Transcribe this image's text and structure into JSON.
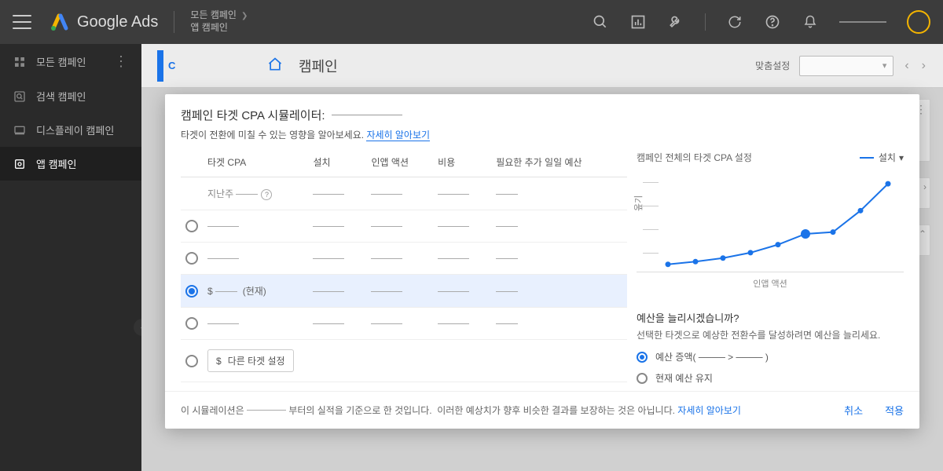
{
  "brand": "Google Ads",
  "crumb1": "모든 캠페인",
  "crumb2": "앱 캠페인",
  "sidebar": {
    "items": [
      {
        "label": "모든 캠페인"
      },
      {
        "label": "검색 캠페인"
      },
      {
        "label": "디스플레이 캠페인"
      },
      {
        "label": "앱 캠페인"
      }
    ]
  },
  "subbar": {
    "title": "캠페인",
    "custom": "맞춤설정"
  },
  "modal": {
    "title": "캠페인 타겟 CPA 시뮬레이터:",
    "subtitle_pre": "타겟이 전환에 미칠 수 있는 영향을 알아보세요. ",
    "subtitle_link": "자세히 알아보기",
    "th_target": "타겟 CPA",
    "th_install": "설치",
    "th_inapp": "인앱 액션",
    "th_cost": "비용",
    "th_extra": "필요한 추가 일일 예산",
    "lastweek": "지난주",
    "current_label": "(현재)",
    "other_target": "다른 타겟 설정",
    "currency": "$",
    "chart_title": "캠페인 전체의 타겟 CPA 설정",
    "chart_metric": "설치",
    "chart_ylabel": "옾기",
    "chart_xlabel": "인앱 액션",
    "budget_q": "예산을 늘리시겠습니까?",
    "budget_d": "선택한 타겟으로 예상한 전환수를 달성하려면 예산을 늘리세요.",
    "budget_opt1": "예산 증액( ──── > ──── )",
    "budget_opt2": "현재 예산 유지",
    "foot_pre": "이 시뮬레이션은",
    "foot_mid1": "부터의 실적을 기준으로 한 것입니다.",
    "foot_mid2": "이러한 예상치가 향후 비슷한 결과를 보장하는 것은 아닙니다.",
    "foot_link": "자세히 알아보기",
    "cancel": "취소",
    "apply": "적용"
  },
  "chart_data": {
    "type": "line",
    "title": "캠페인 전체의 타겟 CPA 설정",
    "xlabel": "인앱 액션",
    "ylabel": "옾기",
    "x": [
      0,
      1,
      2,
      3,
      4,
      5,
      6,
      7,
      8
    ],
    "y": [
      2,
      5,
      9,
      15,
      24,
      36,
      38,
      62,
      92
    ],
    "selected_index": 5,
    "ylim": [
      0,
      100
    ]
  }
}
